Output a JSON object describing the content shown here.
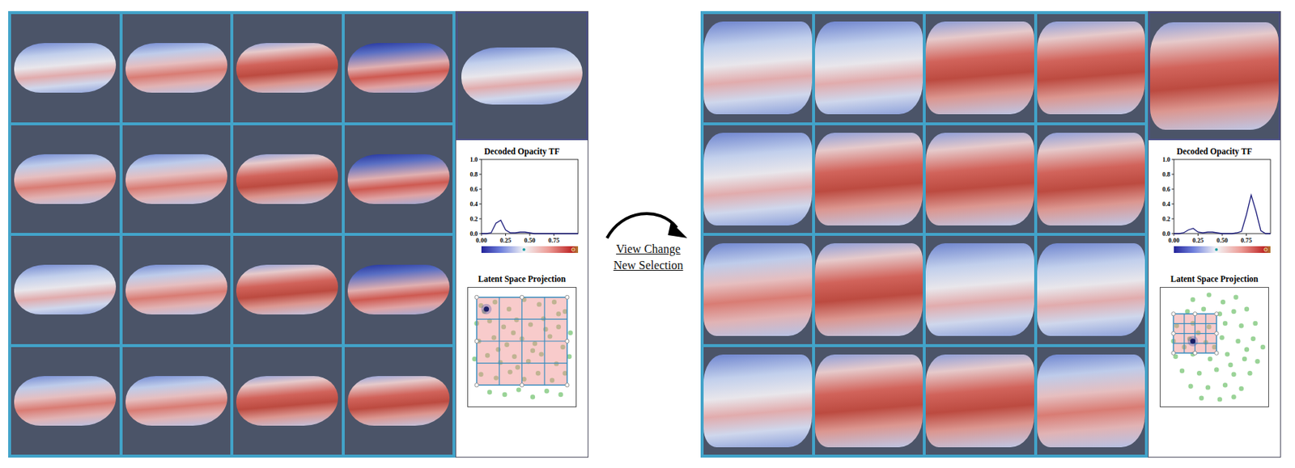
{
  "arrow": {
    "lines": [
      "View Change",
      "New Selection"
    ]
  },
  "panels": [
    {
      "view": "far",
      "cells": [
        {
          "kind": "cool"
        },
        {
          "kind": "warm"
        },
        {
          "kind": "hot"
        },
        {
          "kind": "deep"
        },
        {
          "kind": "warm"
        },
        {
          "kind": "warm"
        },
        {
          "kind": "hot"
        },
        {
          "kind": "deep"
        },
        {
          "kind": "cool"
        },
        {
          "kind": "warm"
        },
        {
          "kind": "hot"
        },
        {
          "kind": "deep"
        },
        {
          "kind": "warm"
        },
        {
          "kind": "warm"
        },
        {
          "kind": "hot"
        },
        {
          "kind": "hot"
        }
      ],
      "preview": {
        "kind": "cool"
      },
      "chart": {
        "title": "Decoded Opacity TF",
        "y_ticks": [
          "0.0",
          "0.2",
          "0.4",
          "0.6",
          "0.8",
          "1.0"
        ],
        "x_ticks": [
          "0.00",
          "0.25",
          "0.50",
          "0.75"
        ],
        "series": [
          0,
          0,
          0.01,
          0.14,
          0.18,
          0.05,
          0.01,
          0.01,
          0.02,
          0.02,
          0.01,
          0,
          0,
          0,
          0,
          0,
          0,
          0,
          0,
          0,
          0
        ],
        "markers": [
          {
            "level": 0.44,
            "color": "#1a9aa0"
          },
          {
            "level": 0.95,
            "color": "#c07020"
          }
        ]
      },
      "projection": {
        "title": "Latent Space Projection",
        "points": [
          [
            0.12,
            0.15
          ],
          [
            0.25,
            0.12
          ],
          [
            0.38,
            0.18
          ],
          [
            0.52,
            0.1
          ],
          [
            0.66,
            0.14
          ],
          [
            0.8,
            0.12
          ],
          [
            0.9,
            0.2
          ],
          [
            0.08,
            0.3
          ],
          [
            0.2,
            0.28
          ],
          [
            0.33,
            0.33
          ],
          [
            0.45,
            0.27
          ],
          [
            0.58,
            0.31
          ],
          [
            0.7,
            0.26
          ],
          [
            0.84,
            0.33
          ],
          [
            0.95,
            0.38
          ],
          [
            0.1,
            0.45
          ],
          [
            0.24,
            0.42
          ],
          [
            0.36,
            0.48
          ],
          [
            0.5,
            0.43
          ],
          [
            0.62,
            0.47
          ],
          [
            0.76,
            0.41
          ],
          [
            0.88,
            0.5
          ],
          [
            0.06,
            0.6
          ],
          [
            0.18,
            0.57
          ],
          [
            0.3,
            0.63
          ],
          [
            0.43,
            0.58
          ],
          [
            0.56,
            0.62
          ],
          [
            0.68,
            0.56
          ],
          [
            0.82,
            0.64
          ],
          [
            0.94,
            0.58
          ],
          [
            0.12,
            0.73
          ],
          [
            0.26,
            0.76
          ],
          [
            0.39,
            0.71
          ],
          [
            0.52,
            0.77
          ],
          [
            0.65,
            0.72
          ],
          [
            0.78,
            0.78
          ],
          [
            0.9,
            0.72
          ],
          [
            0.2,
            0.88
          ],
          [
            0.34,
            0.9
          ],
          [
            0.47,
            0.86
          ],
          [
            0.6,
            0.92
          ],
          [
            0.73,
            0.87
          ],
          [
            0.86,
            0.9
          ],
          [
            0.15,
            0.2
          ],
          [
            0.42,
            0.38
          ],
          [
            0.72,
            0.35
          ],
          [
            0.28,
            0.52
          ],
          [
            0.6,
            0.53
          ],
          [
            0.46,
            0.67
          ],
          [
            0.84,
            0.22
          ]
        ],
        "selection": {
          "x0": 0.08,
          "y0": 0.08,
          "x1": 0.92,
          "y1": 0.82
        },
        "focus": [
          0.17,
          0.18
        ]
      }
    },
    {
      "view": "near",
      "cells": [
        {
          "kind": "cool"
        },
        {
          "kind": "cool"
        },
        {
          "kind": "hot"
        },
        {
          "kind": "hot"
        },
        {
          "kind": "cool"
        },
        {
          "kind": "hot"
        },
        {
          "kind": "hot"
        },
        {
          "kind": "hot"
        },
        {
          "kind": "warm"
        },
        {
          "kind": "hot"
        },
        {
          "kind": "cool"
        },
        {
          "kind": "cool"
        },
        {
          "kind": "cool"
        },
        {
          "kind": "hot"
        },
        {
          "kind": "hot"
        },
        {
          "kind": "warm"
        }
      ],
      "preview": {
        "kind": "hot"
      },
      "chart": {
        "title": "Decoded Opacity TF",
        "y_ticks": [
          "0.0",
          "0.2",
          "0.4",
          "0.6",
          "0.8",
          "1.0"
        ],
        "x_ticks": [
          "0.00",
          "0.25",
          "0.50",
          "0.75"
        ],
        "series": [
          0,
          0,
          0.01,
          0.05,
          0.07,
          0.02,
          0.01,
          0.02,
          0.02,
          0.01,
          0,
          0,
          0,
          0.01,
          0.03,
          0.25,
          0.52,
          0.3,
          0.04,
          0,
          0
        ],
        "markers": [
          {
            "level": 0.44,
            "color": "#1a9aa0"
          },
          {
            "level": 0.95,
            "color": "#c07020"
          }
        ]
      },
      "projection": {
        "title": "Latent Space Projection",
        "points": [
          [
            0.3,
            0.1
          ],
          [
            0.45,
            0.06
          ],
          [
            0.58,
            0.12
          ],
          [
            0.7,
            0.08
          ],
          [
            0.25,
            0.2
          ],
          [
            0.4,
            0.18
          ],
          [
            0.55,
            0.22
          ],
          [
            0.68,
            0.2
          ],
          [
            0.8,
            0.18
          ],
          [
            0.15,
            0.32
          ],
          [
            0.3,
            0.3
          ],
          [
            0.45,
            0.33
          ],
          [
            0.6,
            0.3
          ],
          [
            0.75,
            0.32
          ],
          [
            0.88,
            0.3
          ],
          [
            0.12,
            0.45
          ],
          [
            0.27,
            0.43
          ],
          [
            0.42,
            0.46
          ],
          [
            0.57,
            0.42
          ],
          [
            0.72,
            0.45
          ],
          [
            0.86,
            0.43
          ],
          [
            0.95,
            0.5
          ],
          [
            0.14,
            0.58
          ],
          [
            0.3,
            0.56
          ],
          [
            0.46,
            0.6
          ],
          [
            0.62,
            0.56
          ],
          [
            0.78,
            0.6
          ],
          [
            0.9,
            0.62
          ],
          [
            0.2,
            0.7
          ],
          [
            0.36,
            0.72
          ],
          [
            0.52,
            0.69
          ],
          [
            0.68,
            0.73
          ],
          [
            0.83,
            0.72
          ],
          [
            0.28,
            0.83
          ],
          [
            0.44,
            0.84
          ],
          [
            0.6,
            0.82
          ],
          [
            0.75,
            0.85
          ],
          [
            0.38,
            0.93
          ],
          [
            0.55,
            0.94
          ],
          [
            0.68,
            0.92
          ],
          [
            0.35,
            0.38
          ],
          [
            0.5,
            0.5
          ],
          [
            0.65,
            0.65
          ],
          [
            0.22,
            0.5
          ],
          [
            0.8,
            0.52
          ]
        ],
        "selection": {
          "x0": 0.12,
          "y0": 0.22,
          "x1": 0.52,
          "y1": 0.55
        },
        "focus": [
          0.3,
          0.45
        ]
      }
    }
  ]
}
